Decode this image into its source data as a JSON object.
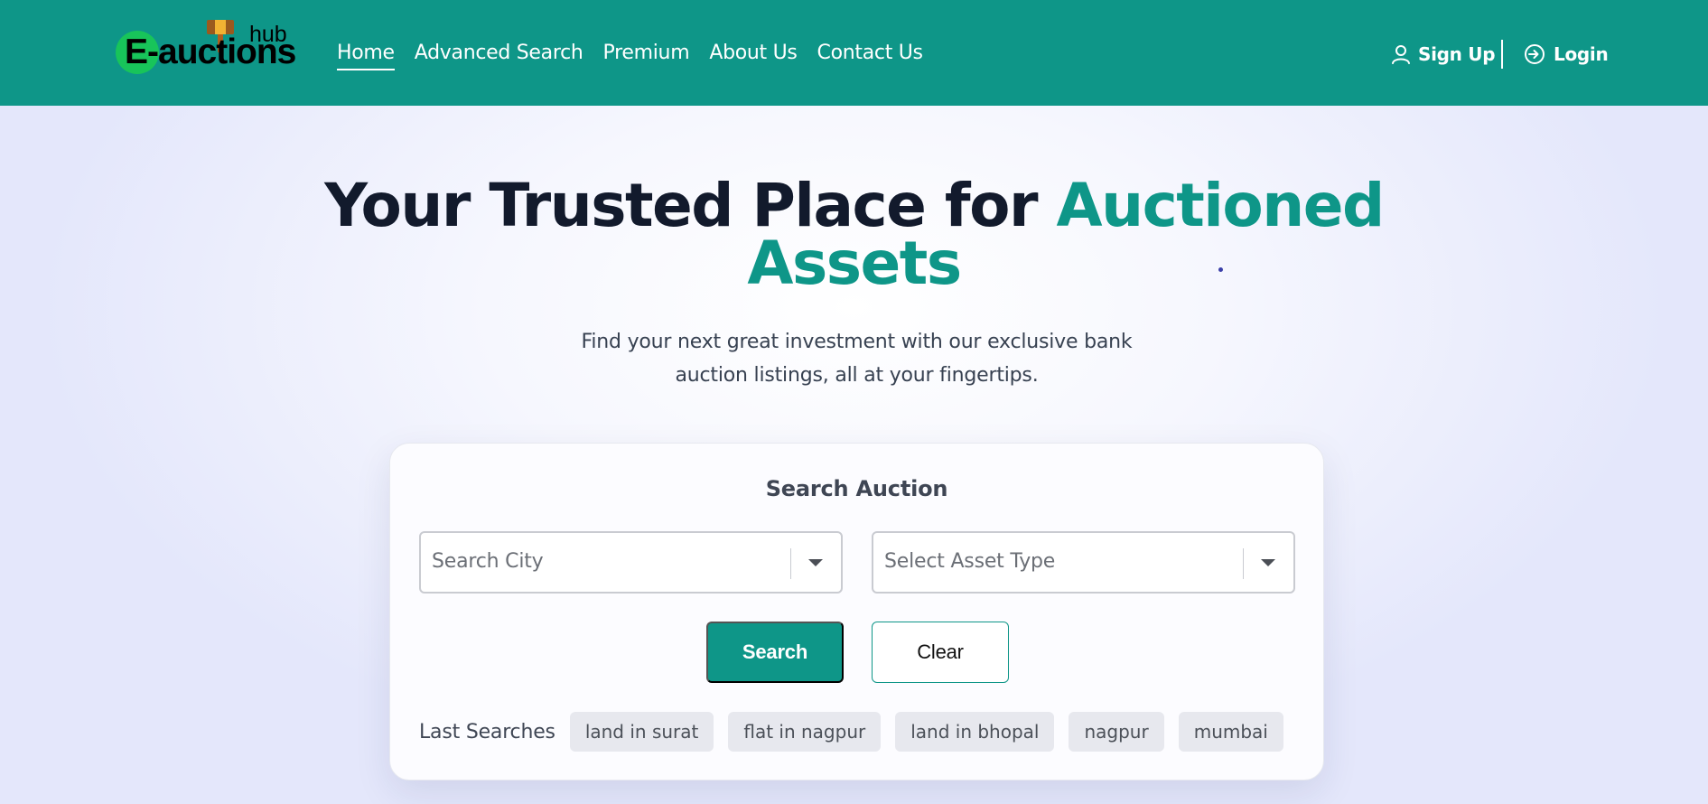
{
  "brand": {
    "logo_text": "E-auctions",
    "logo_suffix": "hub",
    "primary_color": "#0e9688",
    "logo_circle_color": "#18c45a"
  },
  "nav": {
    "items": [
      {
        "label": "Home",
        "active": true
      },
      {
        "label": "Advanced Search",
        "active": false
      },
      {
        "label": "Premium",
        "active": false
      },
      {
        "label": "About Us",
        "active": false
      },
      {
        "label": "Contact Us",
        "active": false
      }
    ],
    "signup": {
      "label": "Sign Up",
      "icon": "user-icon"
    },
    "login": {
      "label": "Login",
      "icon": "login-icon"
    }
  },
  "hero": {
    "title_main": "Your Trusted Place for",
    "title_accent_1": "Auctioned",
    "title_accent_2": "Assets",
    "subtitle_line_1": "Find your next great investment with our exclusive bank",
    "subtitle_line_2": "auction listings, all at your fingertips."
  },
  "search": {
    "title": "Search Auction",
    "city": {
      "placeholder": "Search City",
      "icon": "chevron-down-icon"
    },
    "asset_type": {
      "placeholder": "Select Asset Type",
      "icon": "chevron-down-icon"
    },
    "search_button": "Search",
    "clear_button": "Clear",
    "last_searches_label": "Last Searches",
    "last_searches": [
      "land in surat",
      "flat in nagpur",
      "land in bhopal",
      "nagpur",
      "mumbai"
    ]
  }
}
